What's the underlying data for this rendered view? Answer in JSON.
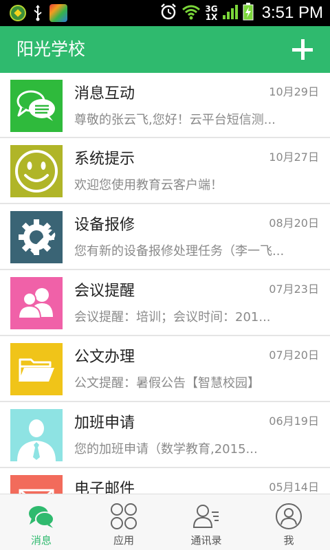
{
  "status_bar": {
    "network_top": "3G",
    "network_bottom": "1X",
    "time": "3:51 PM",
    "icons": [
      "app-badge-icon",
      "usb-icon",
      "app-store-icon",
      "alarm-icon",
      "wifi-icon",
      "signal-icon",
      "battery-charging-icon"
    ]
  },
  "header": {
    "title": "阳光学校",
    "add_icon": "plus-icon",
    "color": "#2fba6e"
  },
  "messages": [
    {
      "title": "消息互动",
      "date": "10月29日",
      "preview": "尊敬的张云飞,您好！云平台短信测...",
      "icon": "chat-bubbles-icon",
      "color": "#2fba3c"
    },
    {
      "title": "系统提示",
      "date": "10月27日",
      "preview": "欢迎您使用教育云客户端！",
      "icon": "smiley-icon",
      "color": "#b0b528"
    },
    {
      "title": "设备报修",
      "date": "08月20日",
      "preview": "您有新的设备报修处理任务（李一飞...",
      "icon": "gear-wrench-icon",
      "color": "#3a6475"
    },
    {
      "title": "会议提醒",
      "date": "07月23日",
      "preview": "会议提醒：培训；会议时间：201...",
      "icon": "people-icon",
      "color": "#f061a8"
    },
    {
      "title": "公文办理",
      "date": "07月20日",
      "preview": "公文提醒：暑假公告【智慧校园】",
      "icon": "folder-icon",
      "color": "#f0c419"
    },
    {
      "title": "加班申请",
      "date": "06月19日",
      "preview": "您的加班申请（数学教育,2015...",
      "icon": "person-tie-icon",
      "color": "#8ee3e3"
    },
    {
      "title": "电子邮件",
      "date": "05月14日",
      "preview": "",
      "icon": "mail-icon",
      "color": "#f26b5b"
    }
  ],
  "bottom_nav": [
    {
      "label": "消息",
      "icon": "chat-icon",
      "active": true
    },
    {
      "label": "应用",
      "icon": "apps-grid-icon",
      "active": false
    },
    {
      "label": "通讯录",
      "icon": "contacts-icon",
      "active": false
    },
    {
      "label": "我",
      "icon": "profile-icon",
      "active": false
    }
  ],
  "colors": {
    "accent": "#2fba6e",
    "nav_inactive": "#666666"
  }
}
